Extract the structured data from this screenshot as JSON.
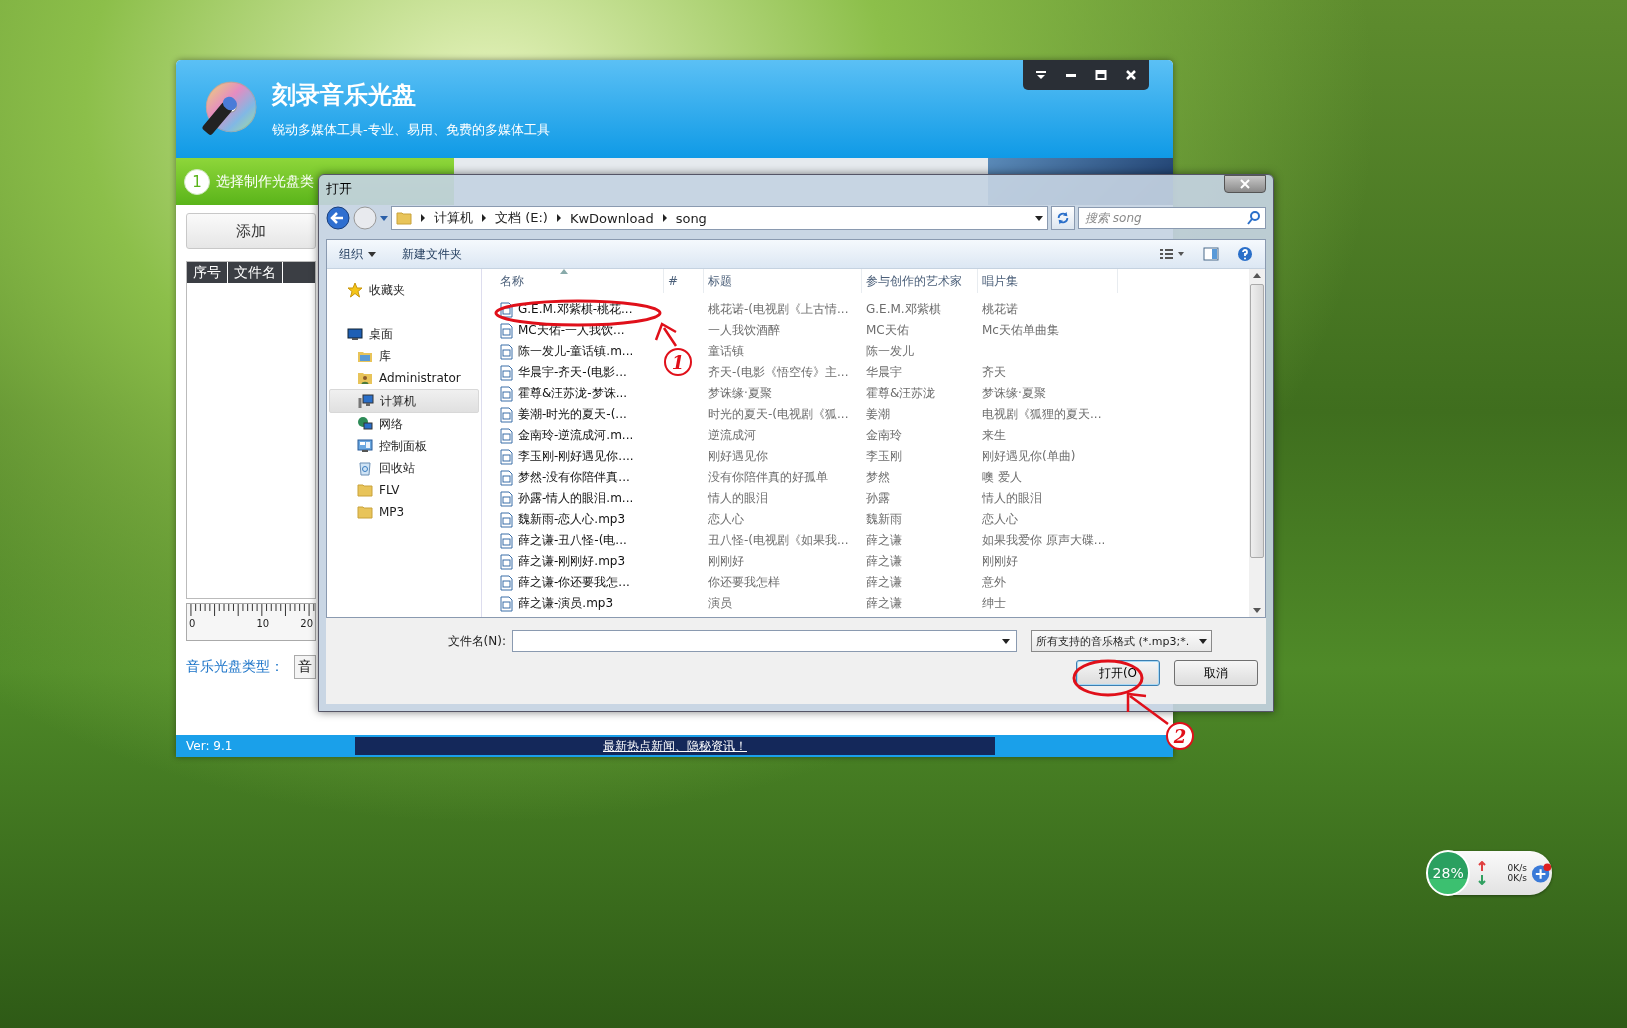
{
  "app_window": {
    "title": "刻录音乐光盘",
    "subtitle": "锐动多媒体工具-专业、易用、免费的多媒体工具",
    "steps": [
      {
        "number": "1",
        "label": "选择制作光盘类",
        "selected": true
      }
    ],
    "add_button": "添加",
    "track_table": {
      "columns": [
        "序号",
        "文件名"
      ]
    },
    "ruler_labels": [
      "0",
      "10",
      "20"
    ],
    "disc_type": {
      "label": "音乐光盘类型：",
      "value": "音"
    },
    "version": "Ver: 9.1",
    "news": "最新热点新闻、隐秘资讯！"
  },
  "dialog": {
    "title": "打开",
    "breadcrumb": [
      "计算机",
      "文档 (E:)",
      "KwDownload",
      "song"
    ],
    "search": {
      "placeholder": "搜索 song"
    },
    "toolbar": [
      {
        "label": "组织",
        "kind": "menu"
      },
      {
        "label": "新建文件夹",
        "kind": "button"
      }
    ],
    "nav": [
      {
        "label": "收藏夹",
        "kind": "favorites",
        "selected": false
      },
      {
        "label": "桌面",
        "kind": "desktop",
        "selected": false,
        "children": [
          {
            "label": "库",
            "kind": "library",
            "selected": false
          },
          {
            "label": "Administrator",
            "kind": "user",
            "selected": false
          },
          {
            "label": "计算机",
            "kind": "computer",
            "selected": true
          },
          {
            "label": "网络",
            "kind": "network",
            "selected": false
          },
          {
            "label": "控制面板",
            "kind": "control-panel",
            "selected": false
          },
          {
            "label": "回收站",
            "kind": "recycle-bin",
            "selected": false
          },
          {
            "label": "FLV",
            "kind": "folder",
            "selected": false
          },
          {
            "label": "MP3",
            "kind": "folder",
            "selected": false
          }
        ]
      }
    ],
    "columns": [
      "名称",
      "#",
      "标题",
      "参与创作的艺术家",
      "唱片集"
    ],
    "files": [
      {
        "name": "G.E.M.邓紫棋-桃花...",
        "title": "桃花诺-(电视剧《上古情...",
        "artist": "G.E.M.邓紫棋",
        "album": "桃花诺",
        "selected": false
      },
      {
        "name": "MC天佑-一人我饮...",
        "title": "一人我饮酒醉",
        "artist": "MC天佑",
        "album": "Mc天佑单曲集",
        "selected": false
      },
      {
        "name": "陈一发儿-童话镇.m...",
        "title": "童话镇",
        "artist": "陈一发儿",
        "selected": false
      },
      {
        "name": "华晨宇-齐天-(电影...",
        "title": "齐天-(电影《悟空传》主...",
        "artist": "华晨宇",
        "album": "齐天",
        "selected": false
      },
      {
        "name": "霍尊&汪苏泷-梦诛...",
        "title": "梦诛缘·夏聚",
        "artist": "霍尊&汪苏泷",
        "album": "梦诛缘·夏聚",
        "selected": false
      },
      {
        "name": "姜潮-时光的夏天-(...",
        "title": "时光的夏天-(电视剧《狐...",
        "artist": "姜潮",
        "album": "电视剧《狐狸的夏天...",
        "selected": false
      },
      {
        "name": "金南玲-逆流成河.m...",
        "title": "逆流成河",
        "artist": "金南玲",
        "album": "来生",
        "selected": false
      },
      {
        "name": "李玉刚-刚好遇见你....",
        "title": "刚好遇见你",
        "artist": "李玉刚",
        "album": "刚好遇见你(单曲)",
        "selected": false
      },
      {
        "name": "梦然-没有你陪伴真...",
        "title": "没有你陪伴真的好孤单",
        "artist": "梦然",
        "album": "噢 爱人",
        "selected": false
      },
      {
        "name": "孙露-情人的眼泪.m...",
        "title": "情人的眼泪",
        "artist": "孙露",
        "album": "情人的眼泪",
        "selected": false
      },
      {
        "name": "魏新雨-恋人心.mp3",
        "title": "恋人心",
        "artist": "魏新雨",
        "album": "恋人心",
        "selected": false
      },
      {
        "name": "薛之谦-丑八怪-(电...",
        "title": "丑八怪-(电视剧《如果我...",
        "artist": "薛之谦",
        "album": "如果我爱你 原声大碟...",
        "selected": false
      },
      {
        "name": "薛之谦-刚刚好.mp3",
        "title": "刚刚好",
        "artist": "薛之谦",
        "album": "刚刚好",
        "selected": false
      },
      {
        "name": "薛之谦-你还要我怎...",
        "title": "你还要我怎样",
        "artist": "薛之谦",
        "album": "意外",
        "selected": false
      },
      {
        "name": "薛之谦-演员.mp3",
        "title": "演员",
        "artist": "薛之谦",
        "album": "绅士",
        "selected": false
      }
    ],
    "filename_label": "文件名(N):",
    "filter": "所有支持的音乐格式 (*.mp3;*.",
    "buttons": [
      {
        "label": "打开(O",
        "kind": "primary"
      },
      {
        "label": "取消",
        "kind": "cancel"
      }
    ]
  },
  "annotations": [
    {
      "text": "1"
    },
    {
      "text": "2"
    }
  ],
  "speed_widget": {
    "percent": "28%",
    "upload": "0K/s",
    "download": "0K/s"
  }
}
